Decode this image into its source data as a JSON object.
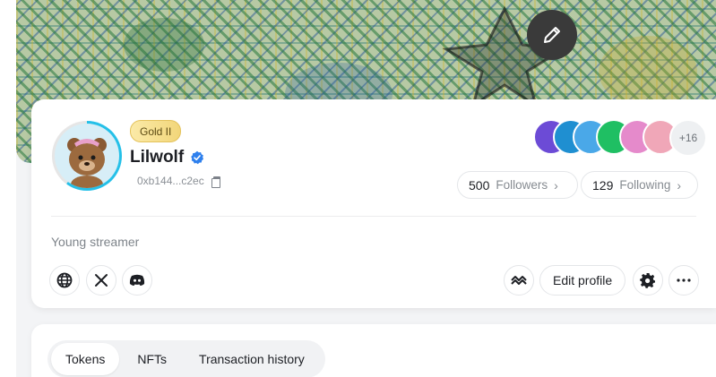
{
  "banner": {
    "edit_icon": "pencil-icon"
  },
  "profile": {
    "tier": "Gold II",
    "name": "Lilwolf",
    "address": "0xb144...c2ec",
    "bio": "Young streamer",
    "verified_color": "#2f80ed"
  },
  "social": {
    "more_avatars": "+16",
    "followers_count": "500",
    "followers_label": "Followers",
    "following_count": "129",
    "following_label": "Following"
  },
  "actions": {
    "links": [
      "globe-icon",
      "x-icon",
      "discord-icon"
    ],
    "edit_profile": "Edit profile"
  },
  "tabs": [
    {
      "label": "Tokens",
      "active": true
    },
    {
      "label": "NFTs",
      "active": false
    },
    {
      "label": "Transaction history",
      "active": false
    }
  ]
}
